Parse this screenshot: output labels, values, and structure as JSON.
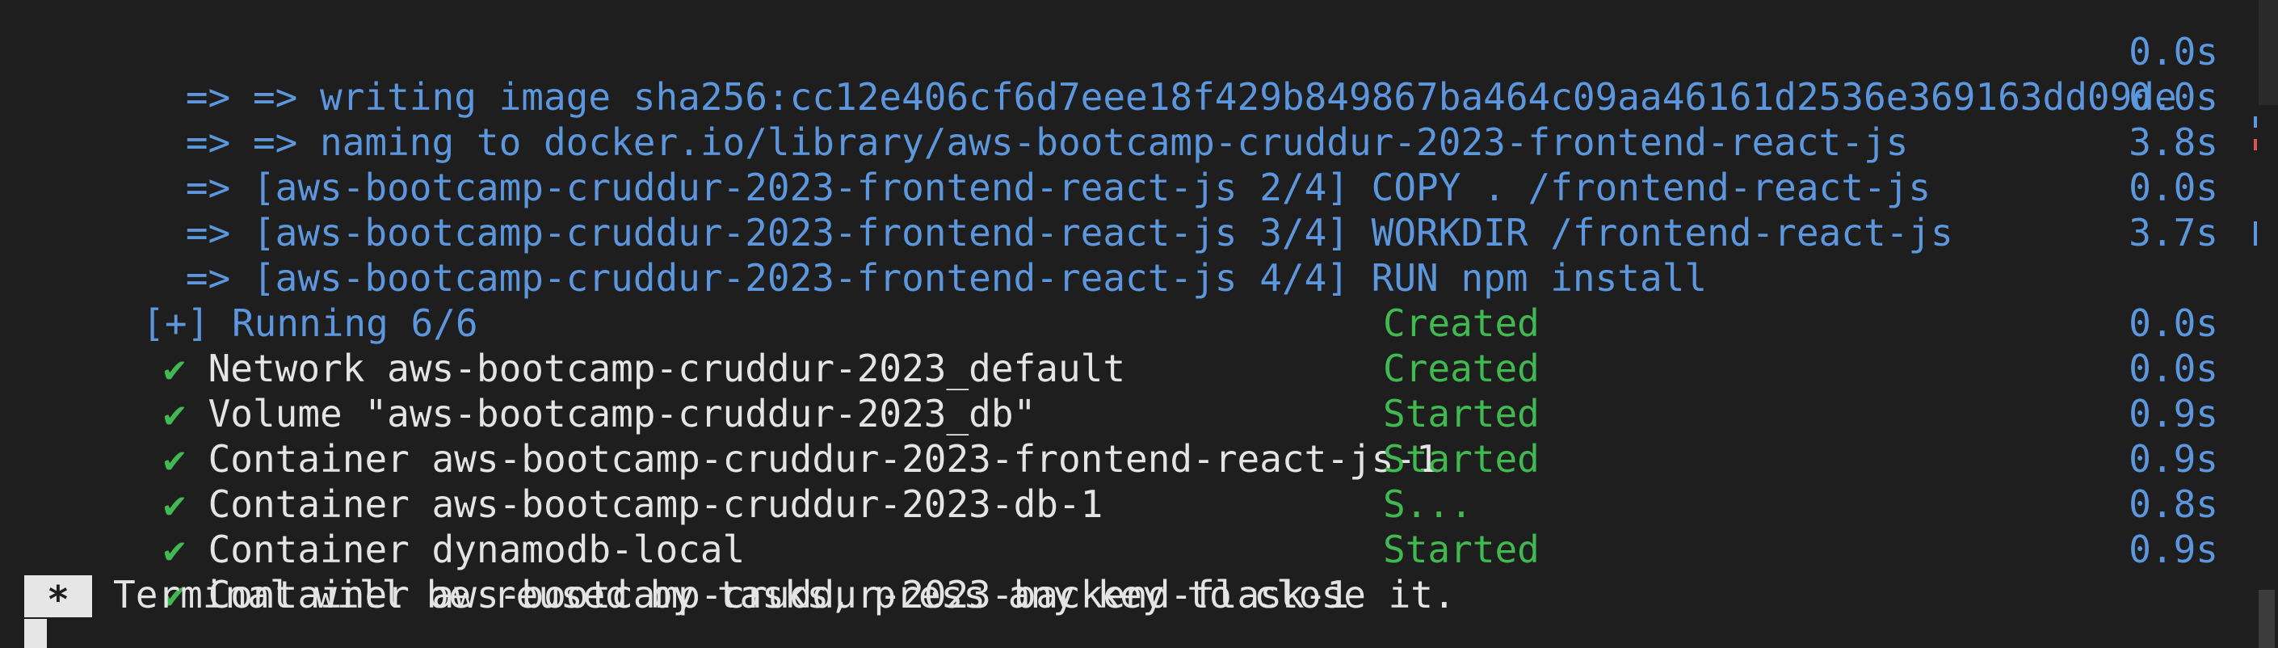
{
  "build_lines": [
    {
      "text": " => => writing image sha256:cc12e406cf6d7eee18f429b849867ba464c09aa46161d2536e369163dd09de",
      "time": "0.0s"
    },
    {
      "text": " => => naming to docker.io/library/aws-bootcamp-cruddur-2023-frontend-react-js",
      "time": "0.0s"
    },
    {
      "text": " => [aws-bootcamp-cruddur-2023-frontend-react-js 2/4] COPY . /frontend-react-js",
      "time": "3.8s"
    },
    {
      "text": " => [aws-bootcamp-cruddur-2023-frontend-react-js 3/4] WORKDIR /frontend-react-js",
      "time": "0.0s"
    },
    {
      "text": " => [aws-bootcamp-cruddur-2023-frontend-react-js 4/4] RUN npm install",
      "time": "3.7s"
    }
  ],
  "running_header": "[+] Running 6/6",
  "resources": [
    {
      "check": "✔",
      "name": "Network aws-bootcamp-cruddur-2023_default",
      "status": "Created",
      "time": "0.0s"
    },
    {
      "check": "✔",
      "name": "Volume \"aws-bootcamp-cruddur-2023_db\"",
      "status": "Created",
      "time": "0.0s"
    },
    {
      "check": "✔",
      "name": "Container aws-bootcamp-cruddur-2023-frontend-react-js-1",
      "status": "Started",
      "time": "0.9s"
    },
    {
      "check": "✔",
      "name": "Container aws-bootcamp-cruddur-2023-db-1",
      "status": "Started",
      "time": "0.9s"
    },
    {
      "check": "✔",
      "name": "Container dynamodb-local",
      "status": "S...",
      "time": "0.8s"
    },
    {
      "check": "✔",
      "name": "Container aws-bootcamp-cruddur-2023-backend-flask-1",
      "status": "Started",
      "time": "0.9s"
    }
  ],
  "prompt": {
    "marker": "*",
    "text": "Terminal will be reused by tasks, press any key to close it."
  },
  "colors": {
    "background": "#1e1e1e",
    "blue": "#5c96dd",
    "green": "#3fb950",
    "text": "#e4e4e4"
  }
}
